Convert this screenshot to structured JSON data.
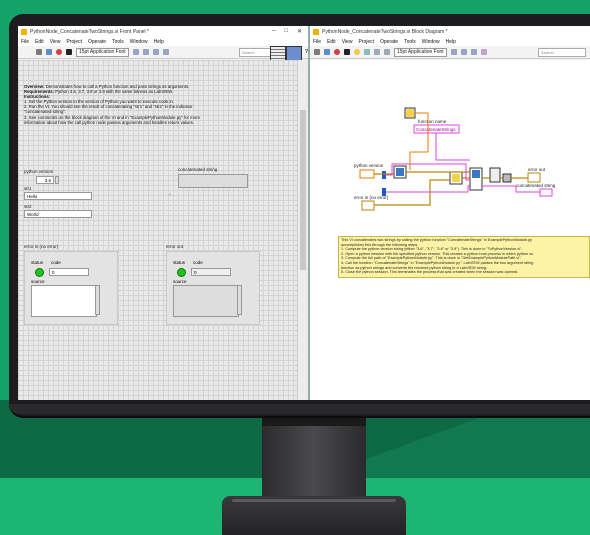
{
  "front_panel": {
    "title": "PythonNode_ConcatenateTwoStrings.vi Front Panel *",
    "menu": [
      "File",
      "Edit",
      "View",
      "Project",
      "Operate",
      "Tools",
      "Window",
      "Help"
    ],
    "toolbar": {
      "font": "15pt Application Font",
      "search_placeholder": "Search",
      "help": "?"
    },
    "window_controls": [
      "–",
      "□",
      "✕"
    ],
    "description": {
      "overview_label": "Overview:",
      "overview": " Demonstrates how to call a Python function and pass strings as arguments.",
      "requirements_label": "Requirements:",
      "requirements": " Python 3.6, 3.7, 3.8 or 3.9 with the same bitness as LabVIEW.",
      "instructions_label": "Instructions:",
      "steps": [
        "1. Set the Python version to the version of Python you want to execute code in.",
        "2. Run the VI. You should see the result of concatenating \"str1\" and \"str2\" in the indicator",
        "\"concatenated string\".",
        "3. See comments on the block diagram of the VI and in \"ExamplePythonModule.py\" for more",
        "information about how the call python node passes arguments and handles return values."
      ]
    },
    "python_version_label": "python version",
    "python_version_value": "3.6",
    "str1_label": "str1",
    "str1_value": "Hello",
    "str2_label": "str2",
    "str2_value": "World",
    "concatenated_label": "concatenated string",
    "error_in": {
      "label": "error in (no error)",
      "status": "status",
      "code": "code",
      "code_value": "0",
      "source": "source"
    },
    "error_out": {
      "label": "error out",
      "status": "status",
      "code": "code",
      "code_value": "0",
      "source": "source"
    }
  },
  "block_diagram": {
    "title": "PythonNode_ConcatenateTwoStrings.vi Block Diagram *",
    "menu": [
      "File",
      "Edit",
      "View",
      "Project",
      "Operate",
      "Tools",
      "Window",
      "Help"
    ],
    "toolbar": {
      "font": "15pt Application Font",
      "search_placeholder": "Search"
    },
    "function_name_label": "function name",
    "function_name_value": "ConcatenateStrings",
    "python_version_label": "python version",
    "error_in_label": "error in (no error)",
    "error_out_label": "error out",
    "concatenated_label": "concatenated string",
    "comment_lines": [
      "This VI concatenates two strings by calling the python function \"ConcatenateStrings\" in ExamplePythonModule.py",
      "accomplishes this through the following steps:",
      "1. Compute the python version string (either \"3.6\", \"3.7\", \"3.8\" or \"3.9\"). This is done in \"ToPythonVersion.vi\".",
      "2. Open a python session with the specified python version. This creates a python host process in which python co",
      "3. Compute the full path of \"ExamplePythonModule.py\". This is done in \"GetExamplePythonModulePath.vi\".",
      "4. Call the function \"ConcatenateStrings\" in \"ExamplePythonModule.py\". LabVIEW passes the two argument string",
      "   function as python strings and converts the returned python string to a LabVIEW string.",
      "5. Close the python session. This terminates the process that was created when the session was opened."
    ]
  },
  "colors": {
    "background": "#16a36a",
    "monitor": "#1d1d1f",
    "comment_bg": "#fdf3a7",
    "wire_string": "#e040e0",
    "wire_error": "#b8860b",
    "status_led": "#1dc41d"
  }
}
